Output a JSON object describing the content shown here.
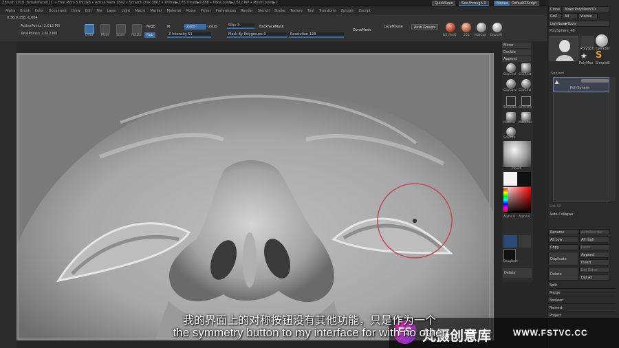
{
  "titlebar": {
    "app": "ZBrush 2018",
    "file": "femaleFace011",
    "stats": "• Free Mem 5.092GB • Active Mem 1842 • Scratch Disk 3803 • RTime▶1.76 Timer▶9.888 • PolyCount▶2.612 MP • MeshCount▶1",
    "quicksave": "QuickSave",
    "seethrough": "See-through 0",
    "menus": "Menus",
    "script": "DefaultZScript"
  },
  "menu": [
    "Alpha",
    "Brush",
    "Color",
    "Document",
    "Draw",
    "Edit",
    "File",
    "Layer",
    "Light",
    "Macro",
    "Marker",
    "Material",
    "Movie",
    "Picker",
    "Preferences",
    "Render",
    "Stencil",
    "Stroke",
    "Texture",
    "Tool",
    "Transform",
    "Zplugin",
    "Zscript"
  ],
  "info": {
    "coords": "0.36,0.158,-1.064",
    "active_points": "ActivePoints: 2.612 Mil",
    "total_points": "TotalPoints: 2.612 Mil"
  },
  "toolshelf": {
    "draw": "Draw",
    "move": "Move",
    "scale": "Scale",
    "rotate": "Rotate",
    "mrgb": "Mrgb",
    "rgb": "Rgb",
    "m": "M",
    "zadd": "Zadd",
    "zsub": "Zsub",
    "zintensity": "Z Intensity 51",
    "sdiv": "SDiv 3",
    "backface": "BackfaceMask",
    "mask_polygroups": "Mask By Polygroups 0",
    "resolution": "Resolution 128",
    "dynamesh": "DynaMesh",
    "lazymouse": "LazyMouse",
    "auto_groups": "Auto Groups",
    "mat1": "RS_Red0",
    "mat2": "255",
    "mat3": "MatCap",
    "mat4": "BasicMi"
  },
  "rightshelf": {
    "mirror": "Mirror",
    "double": "Double",
    "append": "Append",
    "clip_circle": "ClipCircl",
    "clip_rect": "ClipRect",
    "clip_curve": "ClipCurv",
    "clip_circle2": "ClipCircl",
    "select_lasso": "SelectLa",
    "select_rect": "SelectRe",
    "mask_lasso": "MaskLa",
    "mask_rect": "MaskRec",
    "smooth": "Smooth",
    "mat_name": "Mixed",
    "alpha": "Alpha 0",
    "alpha2": "Alpha 0",
    "dragrect": "DragRect",
    "delete": "Delete"
  },
  "panel": {
    "clone": "Clone",
    "make_polymesh": "Make PolyMesh3D",
    "goz": "GoZ",
    "all": "All",
    "visible": "Visible",
    "lightbox": "Lightbox▶Tools",
    "polysphere": "PolySphere_48",
    "tool1": "PolySph",
    "tool2": "Cylinder",
    "tool3": "PolyMes",
    "tool4": "SimpleB",
    "subtool_header": "Subtool",
    "subtool_item": "PolySphere",
    "list_all": "List All",
    "auto_collapse": "Auto Collapse",
    "rename": "Rename",
    "autoreorder": "AutoReorder",
    "all_low": "All Low",
    "all_high": "All High",
    "copy": "Copy",
    "paste": "Paste",
    "duplicate": "Duplicate",
    "append": "Append",
    "insert": "Insert",
    "delete": "Delete",
    "del_other": "Del Other",
    "del_all": "Del All",
    "split": "Split",
    "merge": "Merge",
    "boolean": "Boolean",
    "remesh": "Remesh",
    "project": "Project"
  },
  "subtitles": {
    "cn": "我的界面上的对称按钮没有其他功能，只是作为一个",
    "en": "the symmetry button to my interface for with no other"
  },
  "watermark": {
    "brand": "梵摄创意库",
    "url": "WWW.FSTVC.CC",
    "logo": "FS"
  }
}
